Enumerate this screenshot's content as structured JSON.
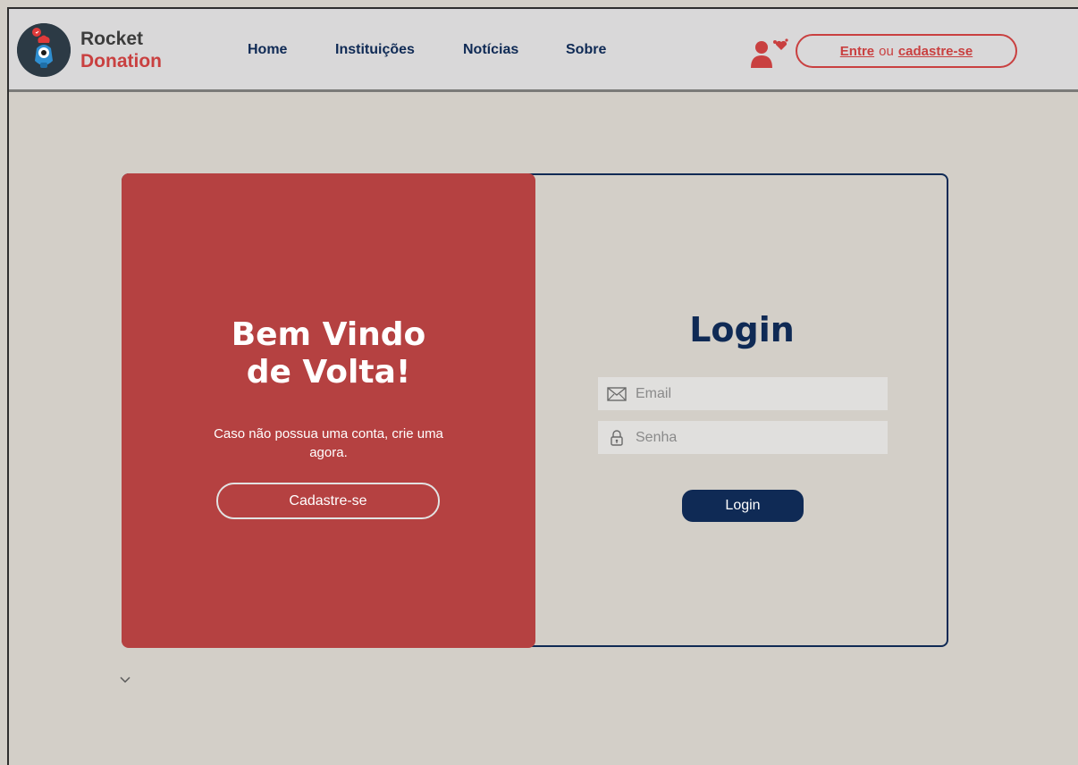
{
  "brand": {
    "line1": "Rocket",
    "line2": "Donation"
  },
  "nav": {
    "items": [
      {
        "label": "Home"
      },
      {
        "label": "Instituições"
      },
      {
        "label": "Notícias"
      },
      {
        "label": "Sobre"
      }
    ]
  },
  "auth": {
    "enter": "Entre",
    "or": "ou",
    "signup": "cadastre-se"
  },
  "welcome": {
    "title_line1": "Bem Vindo",
    "title_line2": "de Volta!",
    "subtitle": "Caso não possua uma conta, crie uma agora.",
    "signup_button": "Cadastre-se"
  },
  "login": {
    "title": "Login",
    "email_placeholder": "Email",
    "password_placeholder": "Senha",
    "button": "Login"
  },
  "icons": {
    "logo": "rocket-mascot-icon",
    "user": "user-heart-icon",
    "email": "envelope-icon",
    "password": "lock-icon",
    "scroll": "chevron-down-icon"
  },
  "colors": {
    "primary_red": "#b54141",
    "accent_red": "#c94040",
    "navy": "#0f2a55",
    "background": "#d3cfc8"
  }
}
